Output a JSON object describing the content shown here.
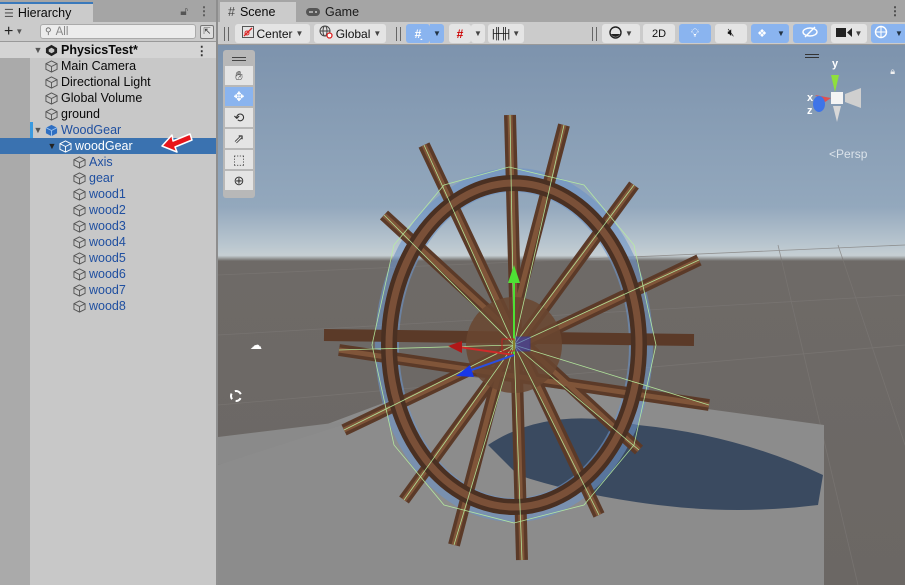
{
  "hierarchy": {
    "tab_label": "Hierarchy",
    "search_placeholder": "All",
    "add_label": "+",
    "scene_name": "PhysicsTest*",
    "items": [
      {
        "label": "Main Camera",
        "level": 1,
        "style": "normal"
      },
      {
        "label": "Directional Light",
        "level": 1,
        "style": "normal"
      },
      {
        "label": "Global Volume",
        "level": 1,
        "style": "normal"
      },
      {
        "label": "ground",
        "level": 1,
        "style": "normal"
      },
      {
        "label": "WoodGear",
        "level": 1,
        "style": "prefab",
        "expanded": true
      },
      {
        "label": "woodGear",
        "level": 2,
        "style": "selected",
        "expanded": true
      },
      {
        "label": "Axis",
        "level": 3,
        "style": "prefab-child"
      },
      {
        "label": "gear",
        "level": 3,
        "style": "prefab-child"
      },
      {
        "label": "wood1",
        "level": 3,
        "style": "prefab-child"
      },
      {
        "label": "wood2",
        "level": 3,
        "style": "prefab-child"
      },
      {
        "label": "wood3",
        "level": 3,
        "style": "prefab-child"
      },
      {
        "label": "wood4",
        "level": 3,
        "style": "prefab-child"
      },
      {
        "label": "wood5",
        "level": 3,
        "style": "prefab-child"
      },
      {
        "label": "wood6",
        "level": 3,
        "style": "prefab-child"
      },
      {
        "label": "wood7",
        "level": 3,
        "style": "prefab-child"
      },
      {
        "label": "wood8",
        "level": 3,
        "style": "prefab-child"
      }
    ]
  },
  "scene": {
    "tabs": [
      {
        "label": "Scene",
        "icon": "grid-icon",
        "active": true
      },
      {
        "label": "Game",
        "icon": "gamepad-icon",
        "active": false
      }
    ],
    "toolbar": {
      "pivot_label": "Center",
      "space_label": "Global",
      "mode_2d_label": "2D"
    },
    "tools": [
      "hand",
      "move",
      "rotate",
      "scale",
      "rect",
      "transform"
    ],
    "active_tool": "move",
    "orientation": {
      "x_label": "x",
      "y_label": "y",
      "z_label": "z",
      "projection_label": "Persp"
    }
  },
  "colors": {
    "accent": "#3a72b0",
    "toggle_on": "#8ab4ef",
    "prefab_text": "#1f4fa0",
    "annotation_arrow": "#e8141a"
  }
}
